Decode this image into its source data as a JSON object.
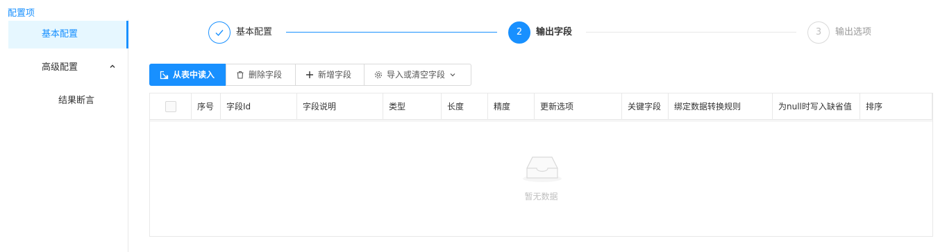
{
  "page": {
    "section_title": "配置项"
  },
  "sidebar": {
    "items": [
      {
        "label": "基本配置",
        "active": true
      },
      {
        "label": "高级配置",
        "expand_icon": "chevron-up-icon"
      }
    ],
    "subitems": [
      {
        "label": "结果断言"
      }
    ]
  },
  "steps": [
    {
      "index": "1",
      "label": "基本配置",
      "status": "finish",
      "icon": "check-icon"
    },
    {
      "index": "2",
      "label": "输出字段",
      "status": "process"
    },
    {
      "index": "3",
      "label": "输出选项",
      "status": "wait"
    }
  ],
  "toolbar": {
    "read_from_table": {
      "label": "从表中读入",
      "icon": "import-icon"
    },
    "delete_field": {
      "label": "删除字段",
      "icon": "trash-icon"
    },
    "add_field": {
      "label": "新增字段",
      "icon": "plus-icon"
    },
    "import_clear": {
      "label": "导入或清空字段",
      "icon": "gear-icon",
      "dropdown_icon": "chevron-down-icon"
    }
  },
  "table": {
    "columns": [
      "序号",
      "字段Id",
      "字段说明",
      "类型",
      "长度",
      "精度",
      "更新选项",
      "关键字段",
      "绑定数据转换规则",
      "为null时写入缺省值",
      "排序"
    ],
    "rows": [],
    "empty_text": "暂无数据"
  },
  "colors": {
    "primary": "#1890ff",
    "border": "#e8e8e8",
    "muted": "#bfbfbf"
  }
}
